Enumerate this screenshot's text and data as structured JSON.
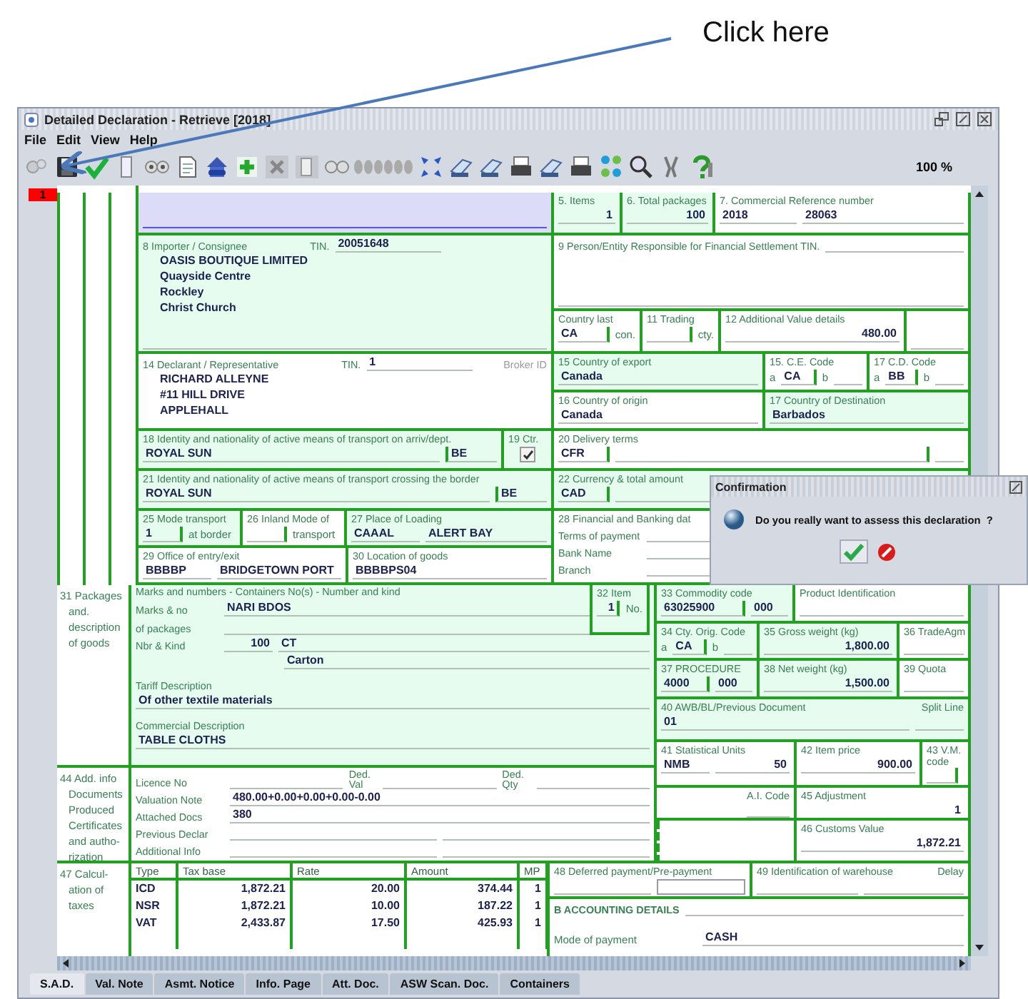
{
  "annotation": {
    "text": "Click here"
  },
  "window": {
    "title": "Detailed Declaration - Retrieve [2018]"
  },
  "menu": [
    "File",
    "Edit",
    "View",
    "Help"
  ],
  "toolbar": {
    "zoom": "100 %"
  },
  "item_badge": "1",
  "form": {
    "items": {
      "label": "5. Items",
      "value": "1"
    },
    "total_packages": {
      "label": "6. Total packages",
      "value": "100"
    },
    "commercial_reference": {
      "label": "7. Commercial Reference number",
      "values": [
        "2018",
        "28063"
      ]
    },
    "importer": {
      "label": "8 Importer / Consignee",
      "tin_label": "TIN.",
      "tin": "20051648",
      "lines": [
        "OASIS BOUTIQUE LIMITED",
        "Quayside Centre",
        "Rockley",
        "Christ Church"
      ]
    },
    "financial_settlement": {
      "label": "9 Person/Entity Responsible for Financial Settlement  TIN."
    },
    "country_last": {
      "label": "Country last",
      "value": "CA",
      "suffix": "con."
    },
    "trading": {
      "label": "11 Trading",
      "suffix": "cty."
    },
    "additional_value": {
      "label": "12 Additional Value details",
      "value": "480.00"
    },
    "declarant": {
      "label": "14 Declarant / Representative",
      "tin_label": "TIN.",
      "tin": "1",
      "broker_label": "Broker ID",
      "lines": [
        "RICHARD ALLEYNE",
        "#11 HILL DRIVE",
        "APPLEHALL"
      ]
    },
    "country_export": {
      "label": "15 Country of export",
      "value": "Canada"
    },
    "ce_code": {
      "label": "15. C.E. Code",
      "a": "a",
      "value": "CA",
      "b": "b"
    },
    "cd_code": {
      "label": "17 C.D. Code",
      "a": "a",
      "value": "BB",
      "b": "b"
    },
    "country_origin": {
      "label": "16 Country of origin",
      "value": "Canada"
    },
    "country_destination": {
      "label": "17 Country of Destination",
      "value": "Barbados"
    },
    "transport_arrival": {
      "label": "18 Identity and nationality of active means of transport on arriv/dept.",
      "value": "ROYAL SUN",
      "nationality": "BE"
    },
    "container": {
      "label": "19 Ctr.",
      "checked": true
    },
    "delivery_terms": {
      "label": "20 Delivery terms",
      "value": "CFR"
    },
    "transport_border": {
      "label": "21 Identity and nationality of active means of transport crossing the border",
      "value": "ROYAL SUN",
      "nationality": "BE"
    },
    "currency": {
      "label": "22 Currency & total amount",
      "value": "CAD"
    },
    "mode_border": {
      "label": "25 Mode transport",
      "value": "1",
      "suffix": "at border"
    },
    "inland_mode": {
      "label": "26 Inland Mode of",
      "suffix": "transport"
    },
    "place_loading": {
      "label": "27 Place of Loading",
      "values": [
        "CAAAL",
        "ALERT BAY"
      ]
    },
    "financial_banking": {
      "label": "28 Financial and Banking dat",
      "rows": [
        "Terms of payment",
        "Bank Name",
        "Branch"
      ]
    },
    "office_entry": {
      "label": "29 Office of entry/exit",
      "values": [
        "BBBBP",
        "BRIDGETOWN PORT"
      ]
    },
    "location_goods": {
      "label": "30 Location of goods",
      "value": "BBBBPS04"
    },
    "packages": {
      "section_label": [
        "31 Packages",
        "and.",
        "description",
        "of goods"
      ],
      "label": "Marks and numbers - Containers No(s) - Number and kind",
      "marks_label": "Marks & no",
      "marks": "NARI BDOS",
      "marks_label_2": "of packages",
      "nbr_label": "Nbr & Kind",
      "nbr": "100",
      "kind_code": "CT",
      "kind": "Carton",
      "tariff_label": "Tariff Description",
      "tariff": "Of other textile materials",
      "commercial_label": "Commercial Description",
      "commercial": "TABLE CLOTHS"
    },
    "item_no": {
      "label": "32 Item",
      "value": "1",
      "suffix": "No."
    },
    "commodity": {
      "label": "33 Commodity code",
      "values": [
        "63025900",
        "000"
      ]
    },
    "product_id": {
      "label": "Product Identification"
    },
    "orig_code": {
      "label": "34 Cty. Orig. Code",
      "a": "a",
      "value": "CA",
      "b": "b"
    },
    "gross": {
      "label": "35 Gross weight (kg)",
      "value": "1,800.00"
    },
    "trade_agm": {
      "label": "36 TradeAgm"
    },
    "procedure": {
      "label": "37 PROCEDURE",
      "values": [
        "4000",
        "000"
      ]
    },
    "net": {
      "label": "38 Net weight (kg)",
      "value": "1,500.00"
    },
    "quota": {
      "label": "39 Quota"
    },
    "previous_doc": {
      "label": "40 AWB/BL/Previous Document",
      "value": "01",
      "split_label": "Split Line"
    },
    "statistical": {
      "label": "41 Statistical Units",
      "values": [
        "NMB",
        "50"
      ]
    },
    "item_price": {
      "label": "42 Item price",
      "value": "900.00"
    },
    "vm_code": {
      "label": "43 V.M.",
      "label_2": "code"
    },
    "additional_info": {
      "section_label": [
        "44 Add. info",
        "Documents",
        "Produced",
        "Certificates",
        "and autho-",
        "rization"
      ],
      "licence_label": "Licence No",
      "ded_val_label": "Ded. Val",
      "ded_qty_label": "Ded. Qty",
      "valuation_label": "Valuation Note",
      "valuation": "480.00+0.00+0.00+0.00-0.00",
      "attached_label": "Attached Docs",
      "attached": "380",
      "previous_label": "Previous Declar",
      "info_label": "Additional Info"
    },
    "ai_code": {
      "label": "A.I. Code"
    },
    "adjustment": {
      "label": "45 Adjustment",
      "value": "1"
    },
    "customs_value": {
      "label": "46 Customs Value",
      "value": "1,872.21"
    },
    "taxes": {
      "section_label": [
        "47 Calcul-",
        "ation of",
        "taxes"
      ],
      "columns": [
        "Type",
        "Tax base",
        "Rate",
        "Amount",
        "MP"
      ],
      "rows": [
        [
          "ICD",
          "1,872.21",
          "20.00",
          "374.44",
          "1"
        ],
        [
          "NSR",
          "1,872.21",
          "10.00",
          "187.22",
          "1"
        ],
        [
          "VAT",
          "2,433.87",
          "17.50",
          "425.93",
          "1"
        ]
      ]
    },
    "deferred_payment": {
      "label": "48 Deferred payment/Pre-payment"
    },
    "warehouse": {
      "label": "49 Identification of warehouse",
      "delay_label": "Delay"
    },
    "accounting": {
      "label": "B ACCOUNTING DETAILS",
      "mode_label": "Mode of payment",
      "mode": "CASH"
    }
  },
  "tabs": [
    {
      "label": "S.A.D.",
      "selected": true
    },
    {
      "label": "Val. Note",
      "selected": false
    },
    {
      "label": "Asmt. Notice",
      "selected": false
    },
    {
      "label": "Info. Page",
      "selected": false
    },
    {
      "label": "Att. Doc.",
      "selected": false
    },
    {
      "label": "ASW Scan. Doc.",
      "selected": false
    },
    {
      "label": "Containers",
      "selected": false
    }
  ],
  "dialog": {
    "title": "Confirmation",
    "message": "Do you really want to assess this declaration  ?"
  }
}
